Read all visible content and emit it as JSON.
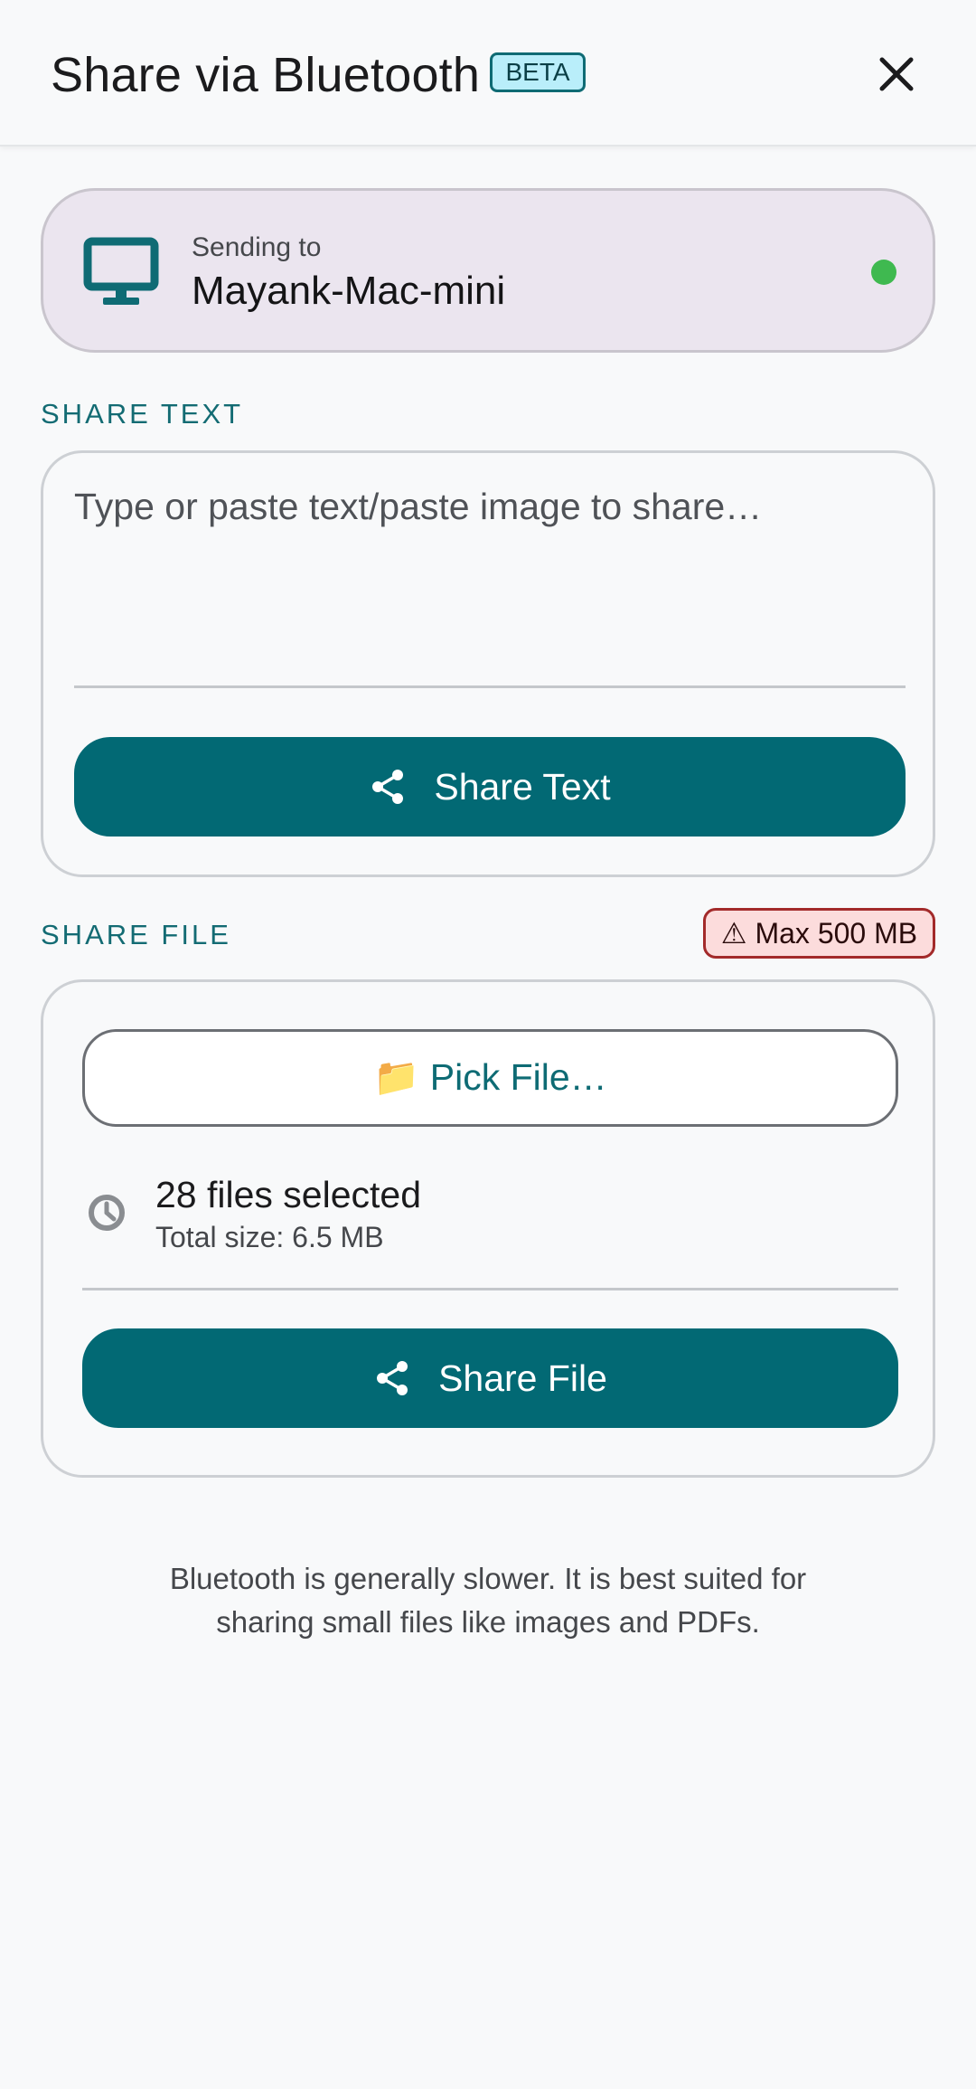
{
  "appbar": {
    "title": "Share via Bluetooth",
    "badge": "BETA",
    "close_icon": "close-icon"
  },
  "device": {
    "sending_label": "Sending to",
    "name": "Mayank-Mac-mini",
    "icon": "monitor-icon",
    "status_color": "#3fb950"
  },
  "share_text": {
    "section_label": "SHARE TEXT",
    "placeholder": "Type or paste text/paste image to share…",
    "value": "",
    "button_label": "Share Text",
    "button_icon": "share-icon"
  },
  "share_file": {
    "section_label": "SHARE FILE",
    "max_badge": "⚠ Max 500 MB",
    "pick_label": "📁 Pick File…",
    "files_count": "28 files selected",
    "files_size": "Total size: 6.5 MB",
    "files_icon": "clock-icon",
    "button_label": "Share File",
    "button_icon": "share-icon"
  },
  "footnote": {
    "line1": "Bluetooth is generally slower. It is best suited for",
    "line2": "sharing small files like images and PDFs."
  },
  "colors": {
    "accent": "#026974",
    "label": "#136b73",
    "device_card_bg": "#ebe5ef",
    "warning_bg": "#fcdcdc",
    "warning_border": "#a32a2a"
  }
}
